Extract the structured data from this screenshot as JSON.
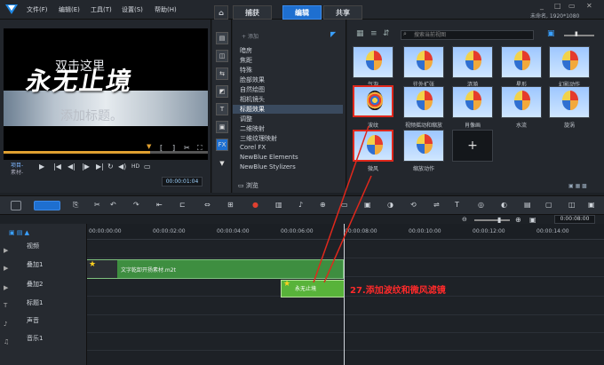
{
  "menu": {
    "file": "文件(F)",
    "edit": "编辑(E)",
    "tools": "工具(T)",
    "settings": "设置(S)",
    "help": "帮助(H)"
  },
  "tabs": {
    "capture": "捕获",
    "edit": "编辑",
    "share": "共享"
  },
  "project_info": "未命名, 1920*1080",
  "preview": {
    "line1": "双击这里",
    "title_overlay": "永无止境",
    "line3": "添加标题。",
    "project_label": "项目-",
    "clip_label": "素材-",
    "hd_label": "HD",
    "timecode": "00:00:01:04"
  },
  "library": {
    "add_label": "添加",
    "categories": [
      "暗房",
      "焦距",
      "特殊",
      "脸部效果",
      "自然绘图",
      "相机镜头",
      "标题效果",
      "调整",
      "二维映射",
      "三维纹理映射",
      "Corel FX",
      "NewBlue Elements",
      "NewBlue Stylizers"
    ],
    "selected_index": 6,
    "browse_label": "浏览",
    "search_placeholder": "搜索当前视图"
  },
  "thumbnails": [
    {
      "label": "气泡"
    },
    {
      "label": "往外扩张"
    },
    {
      "label": "涟漪"
    },
    {
      "label": "星形"
    },
    {
      "label": "幻影动作"
    },
    {
      "label": "波纹"
    },
    {
      "label": "视频摇动和缩放"
    },
    {
      "label": "肖像画"
    },
    {
      "label": "水流"
    },
    {
      "label": "旋涡"
    },
    {
      "label": "微风"
    },
    {
      "label": "缩放动作"
    }
  ],
  "timeline": {
    "ruler": [
      "00:00:00:00",
      "00:00:02:00",
      "00:00:04:00",
      "00:00:06:00",
      "00:00:08:00",
      "00:00:10:00",
      "00:00:12:00",
      "00:00:14:00"
    ],
    "zoom_time": "0:00:08:00",
    "tracks": [
      "视频",
      "叠加1",
      "叠加2",
      "标题1",
      "声音",
      "音乐1"
    ],
    "clip1_label": "文字乾卸开扬素材.m2t",
    "clip2_label": "永无止境"
  },
  "annotation": "27.添加波纹和微风滤镜"
}
